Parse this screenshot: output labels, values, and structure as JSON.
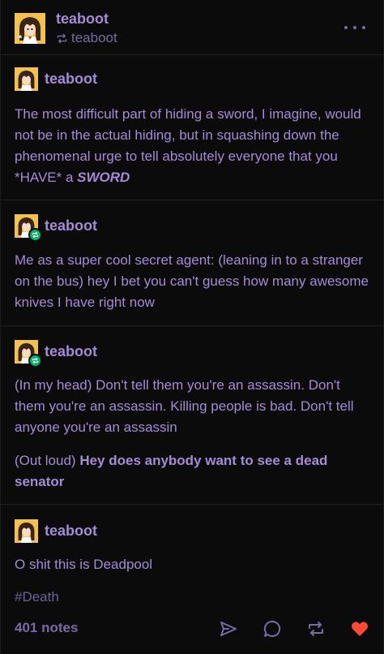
{
  "header": {
    "blog_name": "teaboot",
    "reblogged_from": "teaboot",
    "avatar_icon": "anime-avatar-icon",
    "reblog_icon": "reblog-icon",
    "more_icon": "more-options-icon"
  },
  "trail": [
    {
      "name": "teaboot",
      "reblog": false,
      "paragraphs": [
        {
          "parts": [
            {
              "text": "The most difficult part of hiding a sword, I imagine, would not be in the actual hiding, but in squashing down the phenomenal urge to tell absolutely everyone that you *HAVE* a ",
              "style": "normal"
            },
            {
              "text": "SWORD",
              "style": "emph"
            }
          ]
        }
      ]
    },
    {
      "name": "teaboot",
      "reblog": true,
      "paragraphs": [
        {
          "parts": [
            {
              "text": "Me as a super cool secret agent: (leaning in to a stranger on the bus) hey I bet you can't guess how many awesome knives I have right now",
              "style": "normal"
            }
          ]
        }
      ]
    },
    {
      "name": "teaboot",
      "reblog": true,
      "paragraphs": [
        {
          "parts": [
            {
              "text": "(In my head) Don't tell them you're an assassin. Don't them you're an assassin. Killing people is bad. Don't tell anyone you're an assassin",
              "style": "normal"
            }
          ]
        },
        {
          "parts": [
            {
              "text": "(Out loud) ",
              "style": "normal"
            },
            {
              "text": "Hey does anybody want to see a dead senator",
              "style": "strong"
            }
          ]
        }
      ]
    },
    {
      "name": "teaboot",
      "reblog": false,
      "paragraphs": [
        {
          "parts": [
            {
              "text": "O shit this is Deadpool",
              "style": "normal"
            }
          ]
        }
      ]
    }
  ],
  "tags": [
    "#Death"
  ],
  "footer": {
    "notes_label": "401 notes",
    "share_icon": "share-icon",
    "reply_icon": "reply-icon",
    "reblog_icon": "reblog-icon",
    "like_icon": "heart-icon",
    "like_color": "#ff4930"
  },
  "colors": {
    "background": "#0b0b0c",
    "text": "#a48bd6",
    "muted": "#7a6aa3",
    "reblog_badge": "#00b86b"
  }
}
